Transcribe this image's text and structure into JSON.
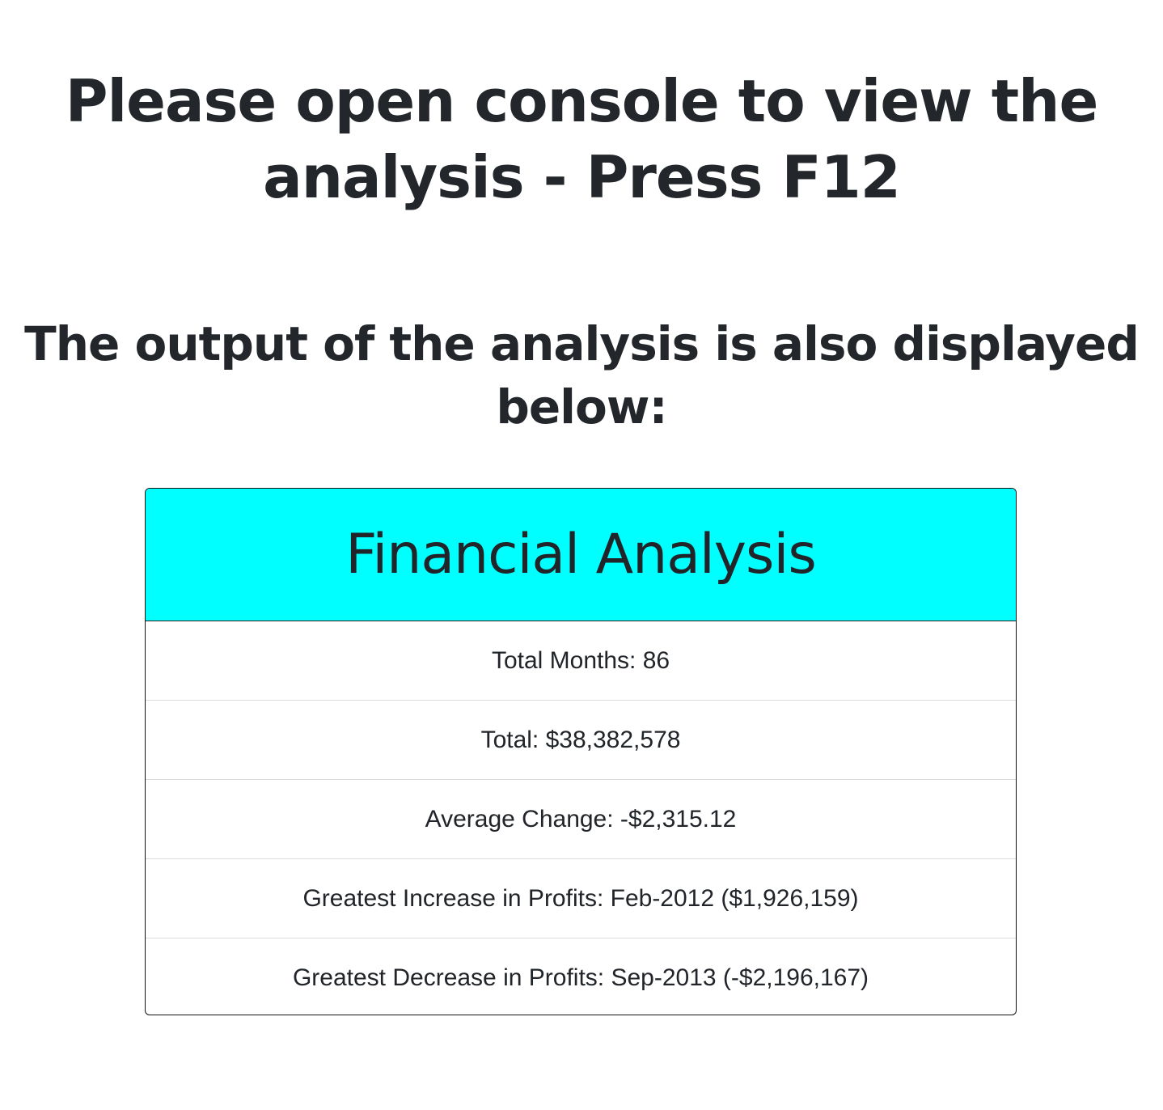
{
  "headline": "Please open console to view the analysis - Press F12",
  "subheadline": "The output of the analysis is also displayed below:",
  "card": {
    "title": "Financial Analysis",
    "items": [
      "Total Months: 86",
      "Total: $38,382,578",
      "Average Change: -$2,315.12",
      "Greatest Increase in Profits: Feb-2012 ($1,926,159)",
      "Greatest Decrease in Profits: Sep-2013 (-$2,196,167)"
    ]
  },
  "colors": {
    "header_background": "#00ffff",
    "text": "#212529",
    "divider": "#dcdcdc"
  }
}
